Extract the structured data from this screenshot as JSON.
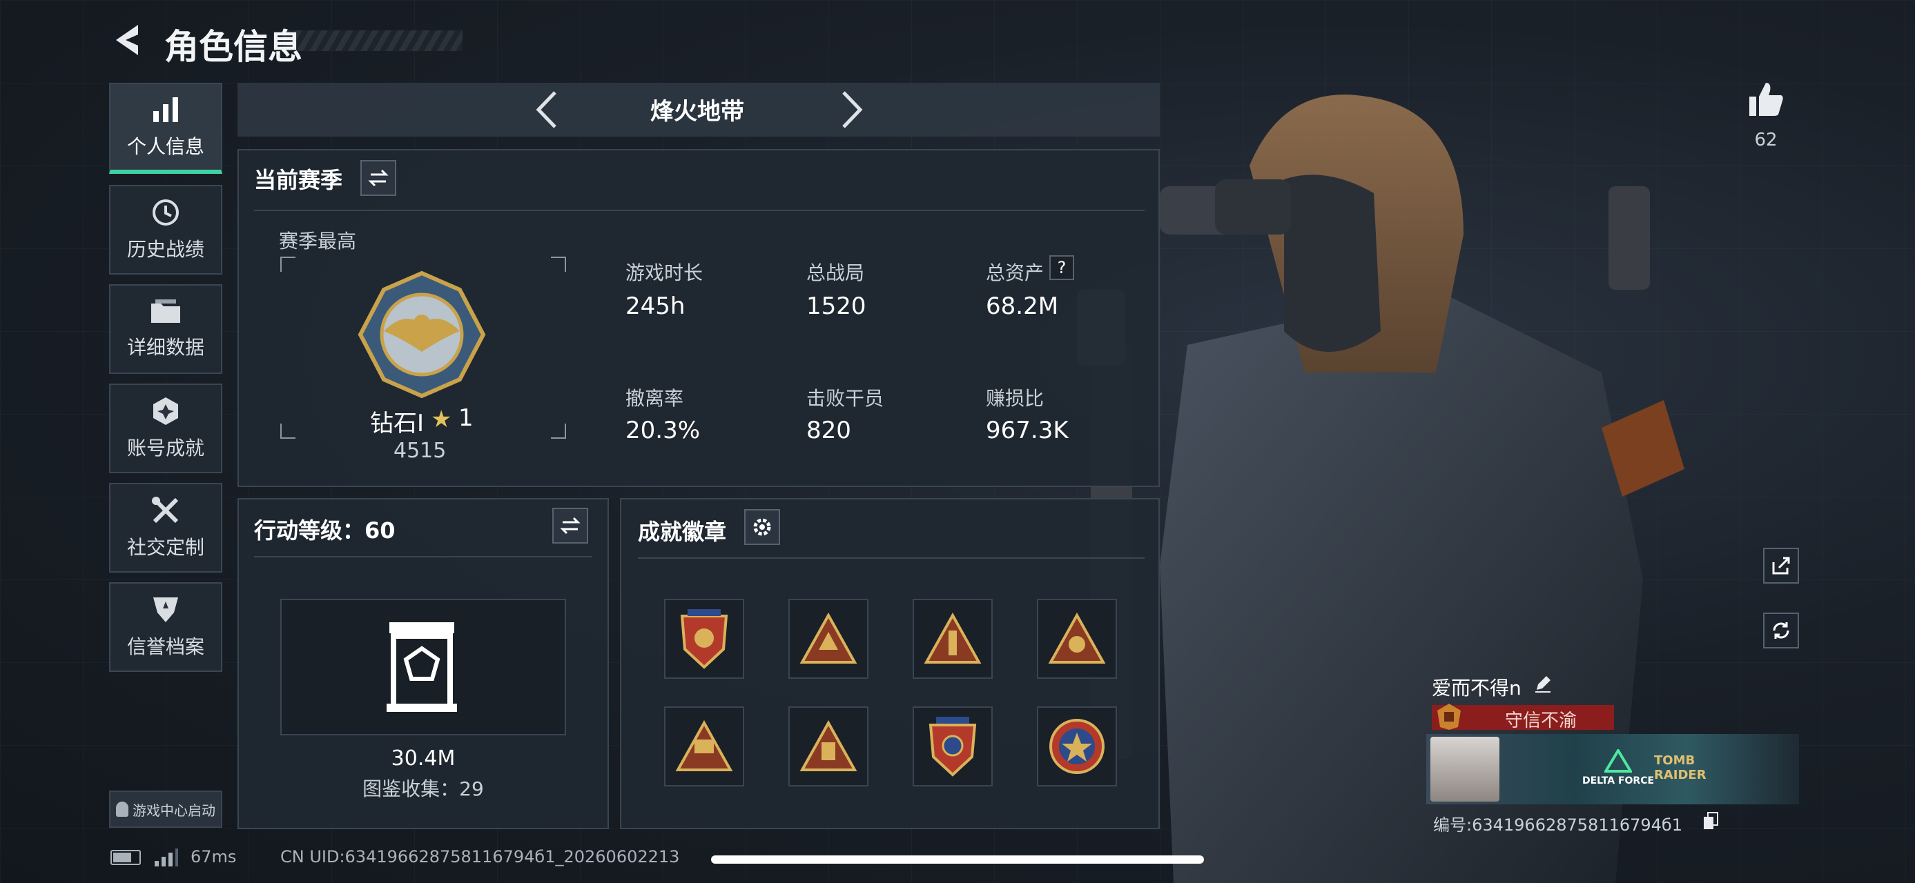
{
  "header": {
    "title": "角色信息"
  },
  "nav": {
    "items": [
      {
        "label": "个人信息",
        "icon": "bar-chart-icon"
      },
      {
        "label": "历史战绩",
        "icon": "clock-icon"
      },
      {
        "label": "详细数据",
        "icon": "folder-icon"
      },
      {
        "label": "账号成就",
        "icon": "achievement-icon"
      },
      {
        "label": "社交定制",
        "icon": "tools-icon"
      },
      {
        "label": "信誉档案",
        "icon": "shield-icon"
      }
    ],
    "game_center": "游戏中心启动"
  },
  "mode": {
    "title": "烽火地带"
  },
  "season": {
    "title": "当前赛季",
    "best_label": "赛季最高",
    "rank_name": "钻石I",
    "rank_stars": "1",
    "rank_score": "4515",
    "stats": [
      {
        "label": "游戏时长",
        "value": "245h"
      },
      {
        "label": "总战局",
        "value": "1520"
      },
      {
        "label": "总资产",
        "value": "68.2M"
      },
      {
        "label": "撤离率",
        "value": "20.3%"
      },
      {
        "label": "击败干员",
        "value": "820"
      },
      {
        "label": "赚损比",
        "value": "967.3K"
      }
    ],
    "help": "?"
  },
  "level": {
    "title": "行动等级：60",
    "value": "30.4M",
    "collection": "图鉴收集：29"
  },
  "badges": {
    "title": "成就徽章"
  },
  "profile": {
    "likes": "62",
    "name": "爱而不得n",
    "tag": "守信不渝",
    "id_text": "编号:634196628758116794б1",
    "banner_text1": "DELTA FORCE",
    "banner_text2": "TOMB RAIDER"
  },
  "status": {
    "ping": "67ms",
    "uid": "CN UID:634196628758116794б1_20260602213"
  },
  "colors": {
    "accent": "#3fd3a4",
    "tag_red": "#8b1d1d",
    "gold": "#c9a24a"
  }
}
